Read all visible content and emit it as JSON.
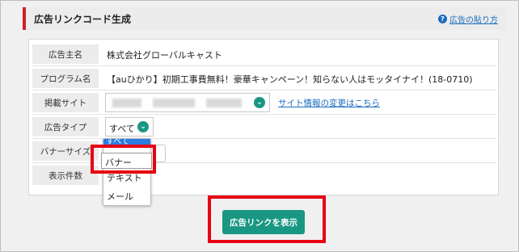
{
  "header": {
    "title": "広告リンクコード生成",
    "help_link": "広告の貼り方",
    "help_icon": "?"
  },
  "form": {
    "rows": [
      {
        "label": "広告主名",
        "value": "株式会社グローバルキャスト"
      },
      {
        "label": "プログラム名",
        "value": "【auひかり】初期工事費無料！豪華キャンペーン！知らない人はモッタイナイ！(18-0710)"
      },
      {
        "label": "掲載サイト",
        "value": ""
      },
      {
        "label": "広告タイプ",
        "value": "すべて"
      },
      {
        "label": "バナーサイズ",
        "value": ""
      },
      {
        "label": "表示件数",
        "value": ""
      }
    ],
    "site_change_link": "サイト情報の変更はこちら",
    "caret_icon": "chevron-down-icon"
  },
  "dropdown": {
    "selected_partial": "すべて",
    "options": [
      "バナー",
      "テキスト",
      "メール"
    ],
    "option_banner": "バナー",
    "option_text": "テキスト",
    "option_mail": "メール"
  },
  "button": {
    "show_label": "広告リンクを表示"
  },
  "colors": {
    "accent": "#1a9783",
    "highlight": "#e60012",
    "header_bar": "#d01f26",
    "link": "#1a6bbf"
  }
}
